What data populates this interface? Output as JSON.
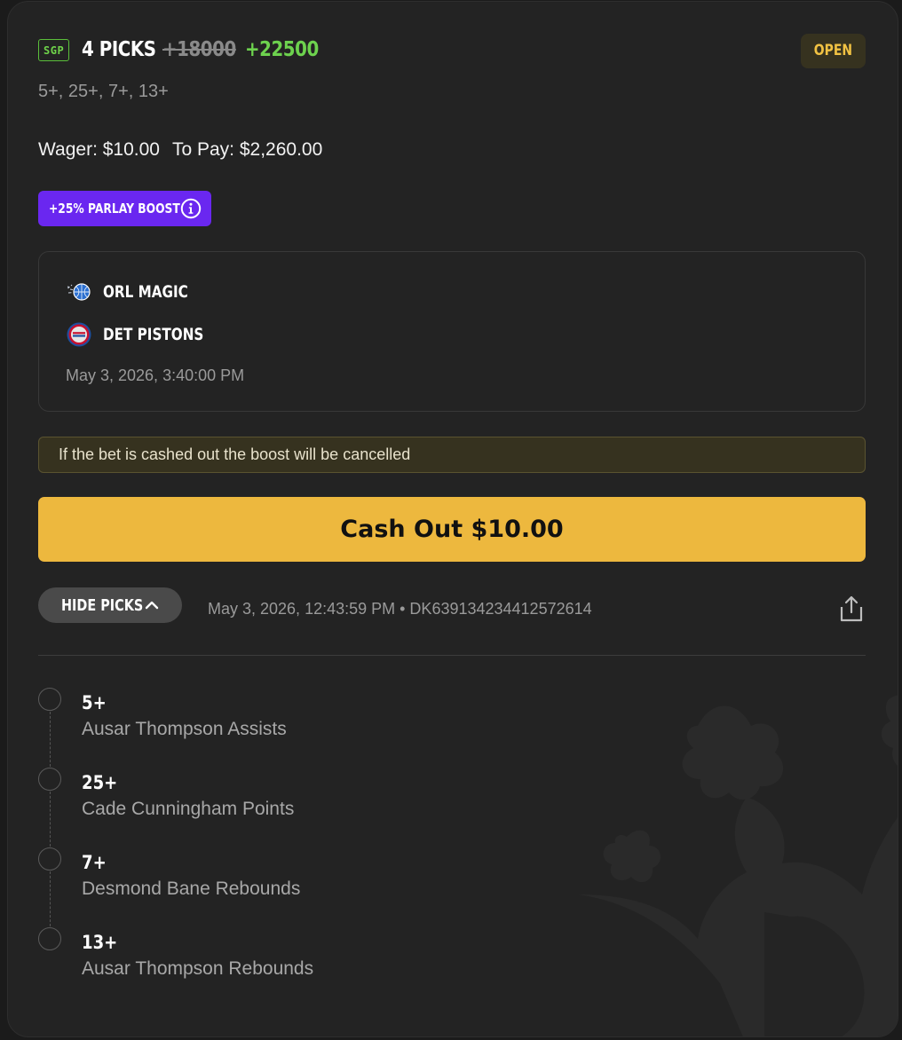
{
  "header": {
    "sgp_badge": "SGP",
    "picks_title": "4 PICKS",
    "original_odds": "+18000",
    "boosted_odds": "+22500",
    "status": "OPEN"
  },
  "subtitle": "5+, 25+, 7+, 13+",
  "wager": {
    "wager_text": "Wager: $10.00",
    "to_pay_text": "To Pay: $2,260.00"
  },
  "boost": {
    "label": "+25% PARLAY BOOST",
    "info_icon": "info-icon"
  },
  "game": {
    "teams": [
      {
        "name": "ORL MAGIC",
        "logo": "orl-magic-logo"
      },
      {
        "name": "DET PISTONS",
        "logo": "det-pistons-logo"
      }
    ],
    "start_time": "May 3, 2026, 3:40:00 PM"
  },
  "warning": "If the bet is cashed out the boost will be cancelled",
  "cashout": {
    "label": "Cash Out $10.00"
  },
  "picks_toggle": {
    "label": "HIDE PICKS",
    "icon": "chevron-up-icon"
  },
  "meta": "May 3, 2026, 12:43:59 PM • DK639134234412572614",
  "share_icon": "share-icon",
  "legs": [
    {
      "value": "5+",
      "description": "Ausar Thompson Assists"
    },
    {
      "value": "25+",
      "description": "Cade Cunningham Points"
    },
    {
      "value": "7+",
      "description": "Desmond Bane Rebounds"
    },
    {
      "value": "13+",
      "description": "Ausar Thompson Rebounds"
    }
  ],
  "colors": {
    "background": "#232323",
    "boost_purple": "#6a27f0",
    "odds_green": "#6dd24e",
    "cashout_yellow": "#edb83e",
    "status_yellow": "#f1c243"
  }
}
